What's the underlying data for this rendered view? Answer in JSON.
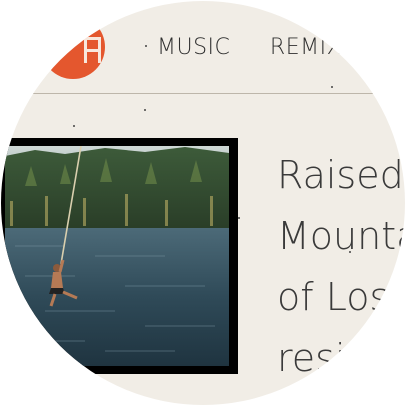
{
  "nav": {
    "items": [
      {
        "label": "MUSIC"
      },
      {
        "label": "REMIX"
      }
    ]
  },
  "logo": {
    "icon": "site-logo",
    "glyph": "H",
    "color": "#e4572e"
  },
  "hero": {
    "image_alt_icon": "rope-swing-lake-photo",
    "text_lines": [
      "Raised",
      "Mountai",
      "of Los",
      "resid"
    ]
  },
  "colors": {
    "background": "#f1ede6",
    "text": "#3a3a3a",
    "accent": "#e4572e"
  }
}
